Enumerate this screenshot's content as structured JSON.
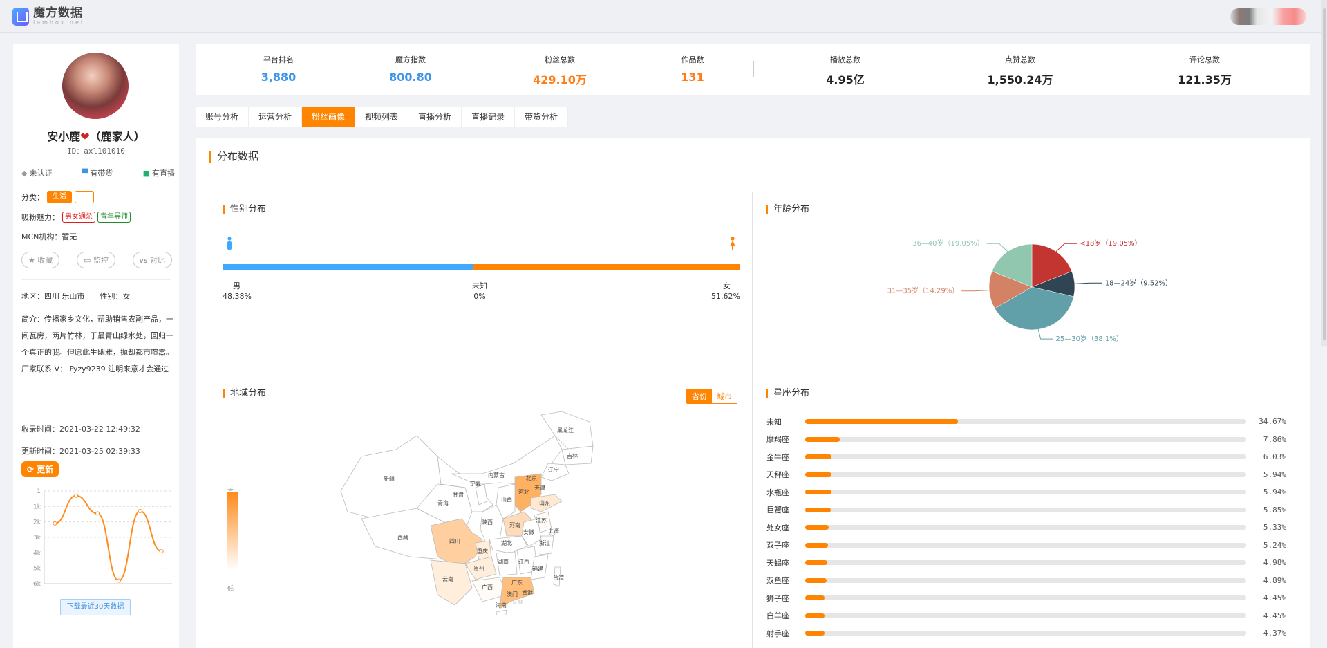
{
  "header": {
    "logo_title": "魔方数据",
    "logo_sub": "iambox.net"
  },
  "profile": {
    "name": "安小鹿",
    "name_emoji": "❤",
    "name_suffix": "（鹿家人）",
    "id": "ID：axl101010",
    "flags": [
      {
        "icon": "diamond-icon",
        "glyph": "◆",
        "label": "未认证",
        "color": "#999999"
      },
      {
        "icon": "cart-icon",
        "glyph": "🛒",
        "label": "有带货",
        "color": "#3e95e8"
      },
      {
        "icon": "live-icon",
        "glyph": "▶",
        "label": "有直播",
        "color": "#20b070"
      }
    ],
    "category_label": "分类：",
    "category": "生活",
    "category_more": "···",
    "charm_label": "吸粉魅力：",
    "charm_tags": [
      "男女通杀",
      "青年导师"
    ],
    "mcn_label": "MCN机构：",
    "mcn_value": "暂无",
    "actions": [
      {
        "icon": "star-icon",
        "glyph": "★",
        "label": "收藏"
      },
      {
        "icon": "monitor-icon",
        "glyph": "▭",
        "label": "监控"
      },
      {
        "icon": "vs-icon",
        "glyph": "VS",
        "label": "对比"
      }
    ],
    "region_label": "地区：",
    "region": "四川 乐山市",
    "gender_label": "性别：",
    "gender": "女",
    "bio_label": "简介：",
    "bio": "传播家乡文化，帮助销售农副产品，一间瓦房，两片竹林，于最青山绿水处，回归一个真正的我。但愿此生幽雅，抛却都市喧嚣。 厂家联系 V： Fyzy9239 注明来意才会通过",
    "recorded_label": "收录时间：",
    "recorded_at": "2021-03-22 12:49:32",
    "updated_label": "更新时间：",
    "updated_at": "2021-03-25 02:39:33",
    "refresh_label": "更新",
    "download_label": "下载最近30天数据"
  },
  "rank_chart": {
    "type": "line",
    "y_ticks": [
      "1",
      "1k",
      "2k",
      "3k",
      "4k",
      "5k",
      "6k"
    ],
    "ylim": [
      1,
      6000
    ],
    "inverted": true,
    "values": [
      2100,
      300,
      1450,
      5800,
      1300,
      3900
    ]
  },
  "stats": [
    {
      "label": "平台排名",
      "value": "3,880",
      "color": "blue"
    },
    {
      "label": "魔方指数",
      "value": "800.80",
      "color": "blue"
    },
    {
      "label": "粉丝总数",
      "value": "429.10万",
      "color": "orange"
    },
    {
      "label": "作品数",
      "value": "131",
      "color": "orange"
    },
    {
      "label": "播放总数",
      "value": "4.95亿",
      "color": "dark"
    },
    {
      "label": "点赞总数",
      "value": "1,550.24万",
      "color": "dark"
    },
    {
      "label": "评论总数",
      "value": "121.35万",
      "color": "dark"
    }
  ],
  "tabs": [
    {
      "label": "账号分析",
      "active": false
    },
    {
      "label": "运营分析",
      "active": false
    },
    {
      "label": "粉丝画像",
      "active": true
    },
    {
      "label": "视频列表",
      "active": false
    },
    {
      "label": "直播分析",
      "active": false
    },
    {
      "label": "直播记录",
      "active": false
    },
    {
      "label": "带货分析",
      "active": false
    }
  ],
  "panel": {
    "title": "分布数据",
    "gender": {
      "title": "性别分布",
      "male_label": "男",
      "male_pct": 48.38,
      "male_text": "48.38%",
      "unknown_label": "未知",
      "unknown_text": "0%",
      "female_label": "女",
      "female_pct": 51.62,
      "female_text": "51.62%",
      "male_color": "#40a9ff",
      "female_color": "#ff8400"
    },
    "age": {
      "title": "年龄分布"
    },
    "region": {
      "title": "地域分布",
      "toggle_on": "省份",
      "toggle_off": "城市",
      "legend_high": "高",
      "legend_low": "低",
      "provinces": [
        {
          "name": "新疆",
          "level": 0
        },
        {
          "name": "西藏",
          "level": 0
        },
        {
          "name": "青海",
          "level": 0
        },
        {
          "name": "甘肃",
          "level": 0
        },
        {
          "name": "宁夏",
          "level": 0
        },
        {
          "name": "内蒙古",
          "level": 0
        },
        {
          "name": "黑龙江",
          "level": 0
        },
        {
          "name": "吉林",
          "level": 0
        },
        {
          "name": "辽宁",
          "level": 0
        },
        {
          "name": "北京",
          "level": 0.9
        },
        {
          "name": "天津",
          "level": 0.9
        },
        {
          "name": "河北",
          "level": 0.9
        },
        {
          "name": "山西",
          "level": 0
        },
        {
          "name": "山东",
          "level": 0.25
        },
        {
          "name": "陕西",
          "level": 0
        },
        {
          "name": "河南",
          "level": 0.4
        },
        {
          "name": "江苏",
          "level": 0.05
        },
        {
          "name": "上海",
          "level": 0.05
        },
        {
          "name": "安徽",
          "level": 0
        },
        {
          "name": "湖北",
          "level": 0
        },
        {
          "name": "浙江",
          "level": 0
        },
        {
          "name": "四川",
          "level": 0.55
        },
        {
          "name": "重庆",
          "level": 0.2
        },
        {
          "name": "湖南",
          "level": 0
        },
        {
          "name": "江西",
          "level": 0
        },
        {
          "name": "福建",
          "level": 0
        },
        {
          "name": "贵州",
          "level": 0.2
        },
        {
          "name": "云南",
          "level": 0.2
        },
        {
          "name": "广西",
          "level": 0.05
        },
        {
          "name": "广东",
          "level": 0.75
        },
        {
          "name": "香港",
          "level": 0
        },
        {
          "name": "澳门",
          "level": 0
        },
        {
          "name": "台湾",
          "level": 0
        },
        {
          "name": "海南",
          "level": 0
        }
      ]
    },
    "zodiac": {
      "title": "星座分布",
      "items": [
        {
          "name": "未知",
          "pct": 34.67,
          "text": "34.67%"
        },
        {
          "name": "摩羯座",
          "pct": 7.86,
          "text": "7.86%"
        },
        {
          "name": "金牛座",
          "pct": 6.03,
          "text": "6.03%"
        },
        {
          "name": "天秤座",
          "pct": 5.94,
          "text": "5.94%"
        },
        {
          "name": "水瓶座",
          "pct": 5.94,
          "text": "5.94%"
        },
        {
          "name": "巨蟹座",
          "pct": 5.85,
          "text": "5.85%"
        },
        {
          "name": "处女座",
          "pct": 5.33,
          "text": "5.33%"
        },
        {
          "name": "双子座",
          "pct": 5.24,
          "text": "5.24%"
        },
        {
          "name": "天蝎座",
          "pct": 4.98,
          "text": "4.98%"
        },
        {
          "name": "双鱼座",
          "pct": 4.89,
          "text": "4.89%"
        },
        {
          "name": "狮子座",
          "pct": 4.45,
          "text": "4.45%"
        },
        {
          "name": "白羊座",
          "pct": 4.45,
          "text": "4.45%"
        },
        {
          "name": "射手座",
          "pct": 4.37,
          "text": "4.37%"
        }
      ]
    }
  },
  "chart_data": {
    "type": "pie",
    "title": "年龄分布",
    "categories": [
      "<18岁",
      "18—24岁",
      "25—30岁",
      "31—35岁",
      "36—40岁"
    ],
    "values": [
      19.05,
      9.52,
      38.1,
      14.29,
      19.05
    ],
    "labels": [
      "<18岁（19.05%）",
      "18—24岁（9.52%）",
      "25—30岁（38.1%）",
      "31—35岁（14.29%）",
      "36—40岁（19.05%）"
    ],
    "colors": [
      "#c23531",
      "#2f4554",
      "#61a0a8",
      "#d48265",
      "#91c7ae"
    ]
  }
}
